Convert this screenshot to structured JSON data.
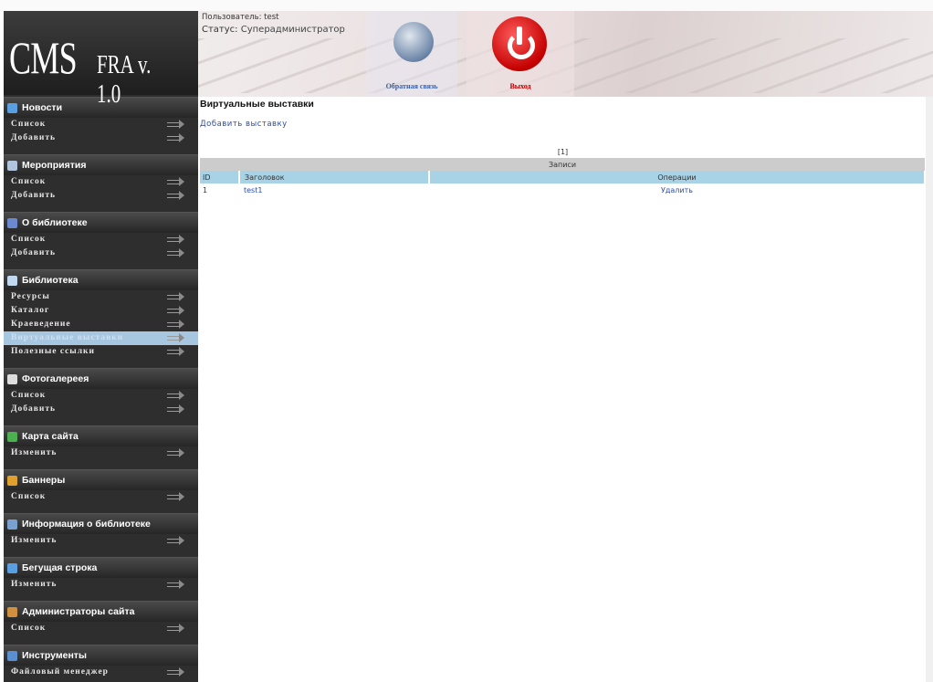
{
  "logo": {
    "cms": "CMS",
    "version": "FRA v. 1.0"
  },
  "header": {
    "user_label": "Пользователь: test",
    "status_label": "Статус:",
    "status_value": "Суперадминистратор",
    "feedback_label": "Обратная связь",
    "exit_label": "Выход"
  },
  "sidebar": {
    "sections": [
      {
        "title": "Новости",
        "icon_color": "#5aa0e0",
        "items": [
          "Список",
          "Добавить"
        ]
      },
      {
        "title": "Мероприятия",
        "icon_color": "#b0c4de",
        "items": [
          "Список",
          "Добавить"
        ]
      },
      {
        "title": "О библиотеке",
        "icon_color": "#6a8acd",
        "items": [
          "Список",
          "Добавить"
        ]
      },
      {
        "title": "Библиотека",
        "icon_color": "#c0d8f0",
        "items": [
          "Ресурсы",
          "Каталог",
          "Краеведение",
          "Виртуальные выставки",
          "Полезные ссылки"
        ]
      },
      {
        "title": "Фотогалереея",
        "icon_color": "#dddddd",
        "items": [
          "Список",
          "Добавить"
        ]
      },
      {
        "title": "Карта сайта",
        "icon_color": "#4caf50",
        "items": [
          "Изменить"
        ]
      },
      {
        "title": "Баннеры",
        "icon_color": "#e0a030",
        "items": [
          "Список"
        ]
      },
      {
        "title": "Информация о библиотеке",
        "icon_color": "#7aa0d0",
        "items": [
          "Изменить"
        ]
      },
      {
        "title": "Бегущая строка",
        "icon_color": "#5aa0e0",
        "items": [
          "Изменить"
        ]
      },
      {
        "title": "Администраторы сайта",
        "icon_color": "#d09040",
        "items": [
          "Список"
        ]
      },
      {
        "title": "Инструменты",
        "icon_color": "#5a90d0",
        "items": [
          "Файловый менеджер"
        ]
      }
    ],
    "active_item": "Виртуальные выставки"
  },
  "main": {
    "title": "Виртуальные выставки",
    "add_link": "Добавить выставку",
    "pager": "[1]",
    "table": {
      "caption": "Записи",
      "columns": [
        "ID",
        "Заголовок",
        "Операции"
      ],
      "rows": [
        {
          "id": "1",
          "title": "test1",
          "op": "Удалить"
        }
      ]
    }
  }
}
